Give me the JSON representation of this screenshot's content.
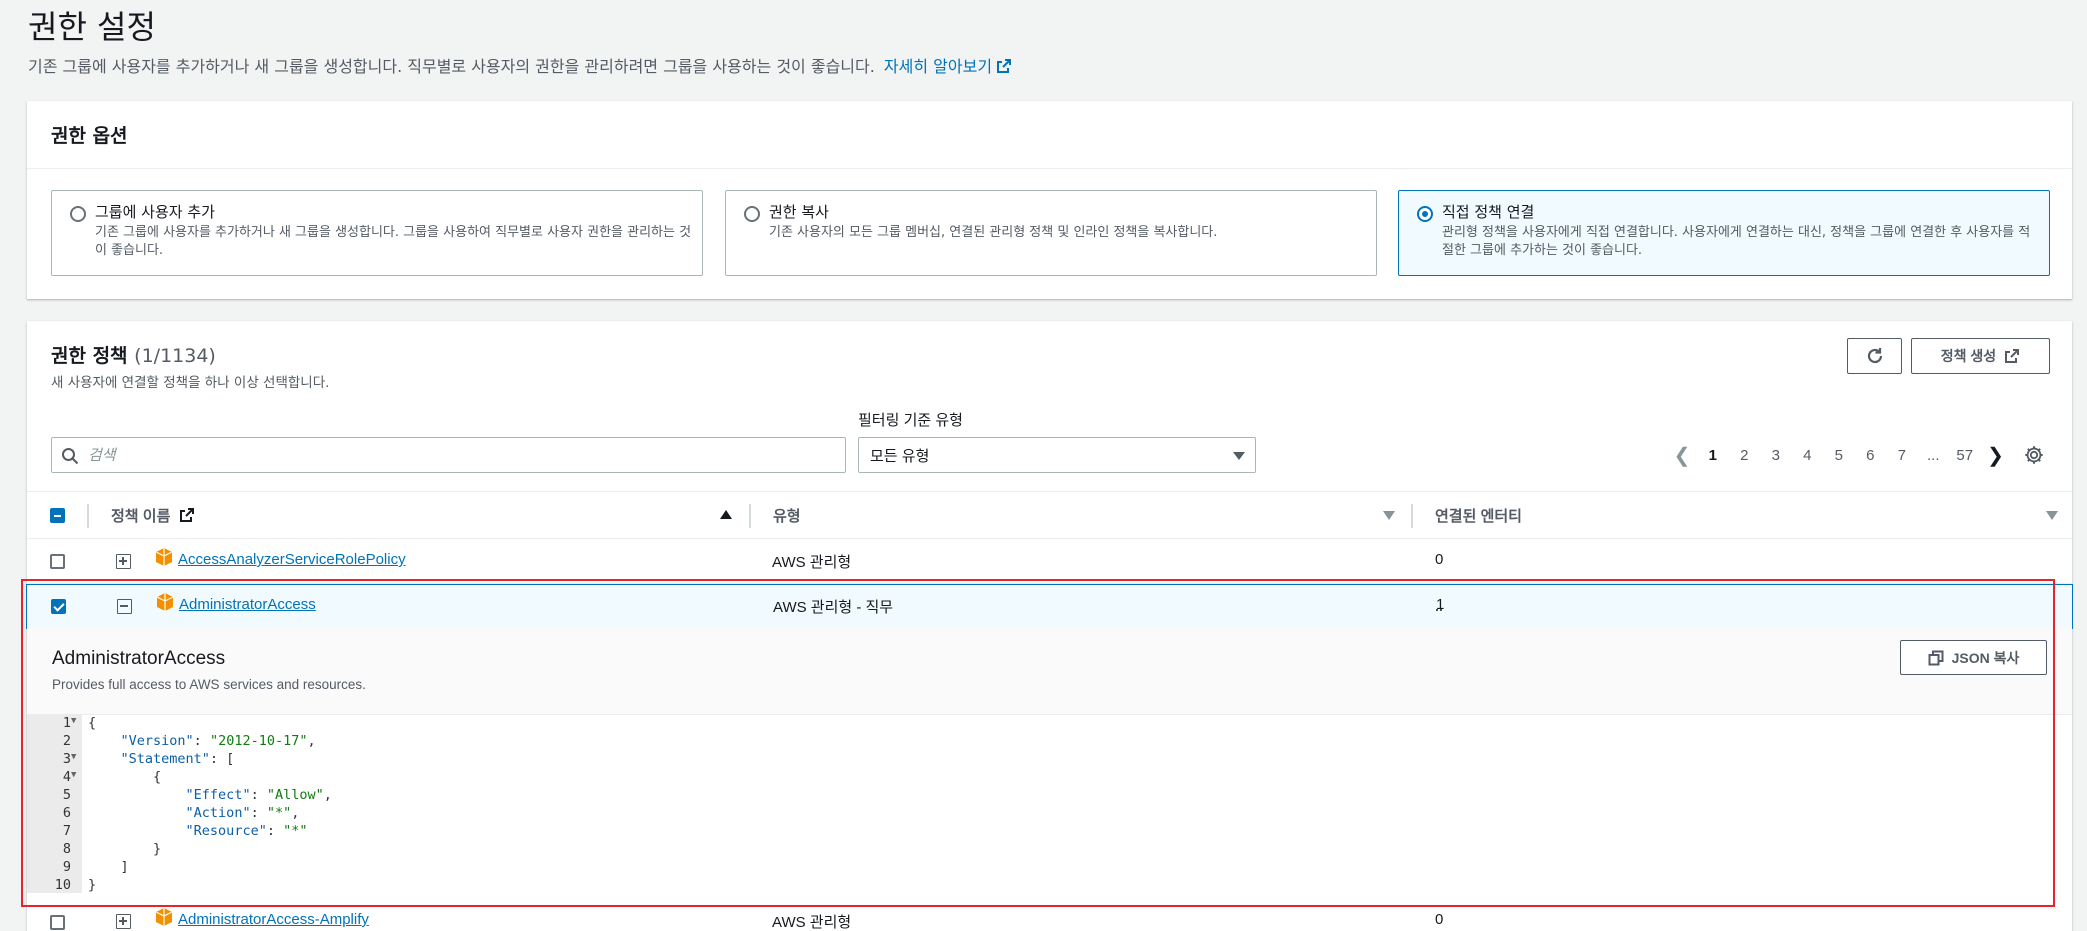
{
  "header": {
    "title": "권한 설정",
    "description": "기존 그룹에 사용자를 추가하거나 새 그룹을 생성합니다. 직무별로 사용자의 권한을 관리하려면 그룹을 사용하는 것이 좋습니다.",
    "learn_more": "자세히 알아보기"
  },
  "options": {
    "title": "권한 옵션",
    "tiles": [
      {
        "title": "그룹에 사용자 추가",
        "desc": "기존 그룹에 사용자를 추가하거나 새 그룹을 생성합니다. 그룹을 사용하여 직무별로 사용자 권한을 관리하는 것이 좋습니다.",
        "selected": false
      },
      {
        "title": "권한 복사",
        "desc": "기존 사용자의 모든 그룹 멤버십, 연결된 관리형 정책 및 인라인 정책을 복사합니다.",
        "selected": false
      },
      {
        "title": "직접 정책 연결",
        "desc": "관리형 정책을 사용자에게 직접 연결합니다. 사용자에게 연결하는 대신, 정책을 그룹에 연결한 후 사용자를 적절한 그룹에 추가하는 것이 좋습니다.",
        "selected": true
      }
    ]
  },
  "policies": {
    "title": "권한 정책",
    "count": "(1/1134)",
    "description": "새 사용자에 연결할 정책을 하나 이상 선택합니다.",
    "create_button": "정책 생성",
    "filter_label": "필터링 기준 유형",
    "search_placeholder": "검색",
    "filter_value": "모든 유형",
    "pages": [
      "1",
      "2",
      "3",
      "4",
      "5",
      "6",
      "7",
      "...",
      "57"
    ],
    "current_page": "1",
    "columns": {
      "name": "정책 이름",
      "type": "유형",
      "entities": "연결된 엔터티"
    },
    "rows": [
      {
        "name": "AccessAnalyzerServiceRolePolicy",
        "type": "AWS 관리형",
        "entities": "0",
        "checked": false,
        "expanded": false
      },
      {
        "name": "AdministratorAccess",
        "type": "AWS 관리형 - 직무",
        "entities": "1",
        "checked": true,
        "expanded": true
      },
      {
        "name": "AdministratorAccess-Amplify",
        "type": "AWS 관리형",
        "entities": "0",
        "checked": false,
        "expanded": false
      }
    ],
    "detail": {
      "title": "AdministratorAccess",
      "description": "Provides full access to AWS services and resources.",
      "copy_button": "JSON 복사",
      "code_lines": [
        "1",
        "2",
        "3",
        "4",
        "5",
        "6",
        "7",
        "8",
        "9",
        "10"
      ]
    }
  },
  "colors": {
    "accent": "#0073bb",
    "highlight": "#e8242a",
    "policy_icon": "#f29100"
  }
}
